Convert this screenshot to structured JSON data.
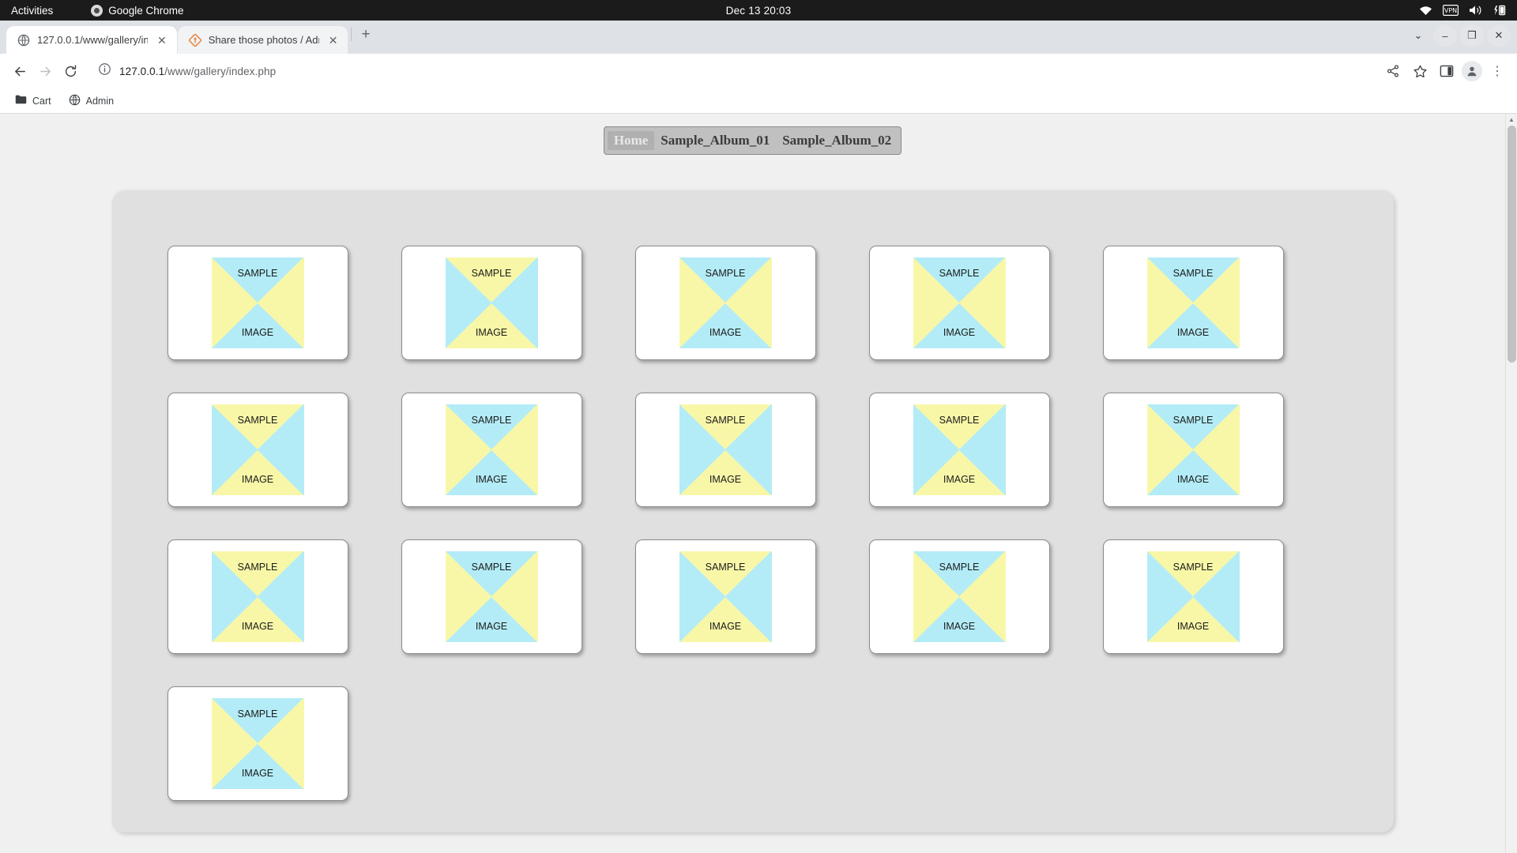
{
  "os_bar": {
    "activities": "Activities",
    "app_name": "Google Chrome",
    "clock": "Dec 13  20:03",
    "tray_icons": [
      "wifi-icon",
      "vpn-icon",
      "volume-icon",
      "battery-icon"
    ]
  },
  "browser": {
    "tabs": [
      {
        "title": "127.0.0.1/www/gallery/in",
        "favicon": "globe-icon",
        "active": true
      },
      {
        "title": "Share those photos / Adm",
        "favicon": "gallery-diamond-icon",
        "active": false
      }
    ],
    "new_tab_label": "+",
    "window_controls": {
      "dropdown": "⌄",
      "minimize": "–",
      "maximize": "❐",
      "close": "✕"
    },
    "toolbar": {
      "back_label": "←",
      "forward_label": "→",
      "reload_label": "⟳",
      "info_label": "ⓘ",
      "url_host": "127.0.0.1",
      "url_path": "/www/gallery/index.php",
      "share_label": "share-icon",
      "bookmark_label": "star-icon",
      "sidepanel_label": "side-panel-icon",
      "profile_label": "profile-avatar",
      "menu_label": "⋮"
    },
    "bookmarks": [
      {
        "label": "Cart",
        "icon": "folder-icon"
      },
      {
        "label": "Admin",
        "icon": "globe-icon"
      }
    ]
  },
  "page": {
    "nav": [
      {
        "label": "Home",
        "current": true
      },
      {
        "label": "Sample_Album_01",
        "current": false
      },
      {
        "label": "Sample_Album_02",
        "current": false
      }
    ],
    "thumbnail_label_top": "SAMPLE",
    "thumbnail_label_bottom": "IMAGE",
    "colors": {
      "cyan": "#b3ecf7",
      "yellow": "#f8f7a8",
      "page_background": "#f0f0f0",
      "gallery_background": "#e0e0e0",
      "nav_background": "#c0c0c0",
      "nav_current_background": "#b0b0b0"
    },
    "thumbnails": [
      {
        "index": 1,
        "orientation": "cyan-vertical"
      },
      {
        "index": 2,
        "orientation": "yellow-vertical"
      },
      {
        "index": 3,
        "orientation": "cyan-vertical"
      },
      {
        "index": 4,
        "orientation": "cyan-vertical"
      },
      {
        "index": 5,
        "orientation": "cyan-vertical"
      },
      {
        "index": 6,
        "orientation": "yellow-vertical"
      },
      {
        "index": 7,
        "orientation": "cyan-vertical"
      },
      {
        "index": 8,
        "orientation": "yellow-vertical"
      },
      {
        "index": 9,
        "orientation": "yellow-vertical"
      },
      {
        "index": 10,
        "orientation": "cyan-vertical"
      },
      {
        "index": 11,
        "orientation": "yellow-vertical"
      },
      {
        "index": 12,
        "orientation": "cyan-vertical"
      },
      {
        "index": 13,
        "orientation": "yellow-vertical"
      },
      {
        "index": 14,
        "orientation": "cyan-vertical"
      },
      {
        "index": 15,
        "orientation": "yellow-vertical"
      },
      {
        "index": 16,
        "orientation": "cyan-vertical"
      }
    ],
    "thumbnail_count": 16
  }
}
